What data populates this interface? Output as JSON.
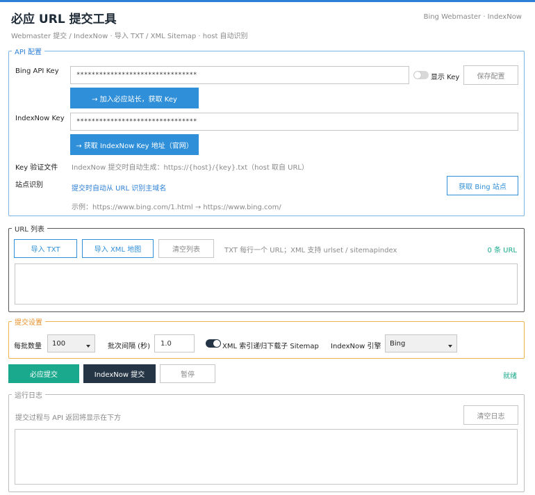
{
  "header": {
    "title": "必应 URL 提交工具",
    "subtitle": "Webmaster 提交 / IndexNow · 导入 TXT / XML Sitemap · host 自动识别",
    "brand": "Bing Webmaster · IndexNow"
  },
  "api": {
    "legend": "API 配置",
    "bing_key_label": "Bing API Key",
    "bing_key_value": "********************************",
    "show_key_label": "显示 Key",
    "save_label": "保存配置",
    "add_bing_label": "→ 加入必应站长，获取 Key",
    "indexnow_key_label": "IndexNow Key",
    "indexnow_key_value": "********************************",
    "get_indexnow_label": "→ 获取 IndexNow Key 地址（官网）",
    "verify_label": "Key 验证文件",
    "verify_text": "IndexNow 提交时自动生成：https://{host}/{key}.txt（host 取自 URL）",
    "site_label": "站点识别",
    "site_text": "提交时自动从 URL 识别主域名",
    "get_bing_site_label": "获取 Bing 站点",
    "example_text": "示例：https://www.bing.com/1.html → https://www.bing.com/"
  },
  "url_list": {
    "legend": "URL 列表",
    "import_txt": "导入 TXT",
    "import_xml": "导入 XML 地图",
    "clear": "清空列表",
    "hint": "TXT 每行一个 URL；XML 支持 urlset / sitemapindex",
    "count": "0 条 URL"
  },
  "submit_settings": {
    "legend": "提交设置",
    "batch_label": "每批数量",
    "batch_value": "100",
    "interval_label": "批次间隔 (秒)",
    "interval_value": "1.0",
    "xml_toggle_label": "XML 索引递归下载子 Sitemap",
    "engine_label": "IndexNow 引擎",
    "engine_value": "Bing"
  },
  "actions": {
    "bing_submit": "必应提交",
    "indexnow_submit": "IndexNow 提交",
    "pause": "暂停",
    "status": "就绪"
  },
  "log": {
    "legend": "运行日志",
    "hint": "提交过程与 API 返回将显示在下方",
    "clear": "清空日志"
  },
  "colors": {
    "accent": "#2f8fd8",
    "teal": "#1aa98c",
    "dark": "#253545",
    "orange": "#e8912a"
  }
}
